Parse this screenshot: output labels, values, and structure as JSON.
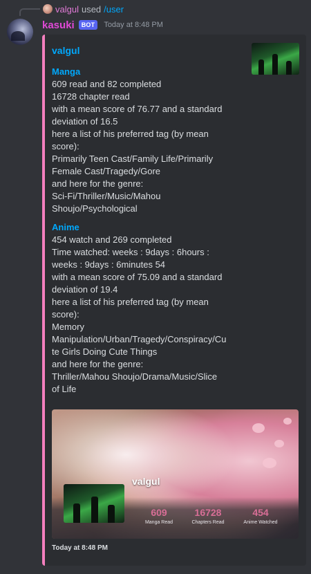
{
  "reply": {
    "username": "valgul",
    "used_text": "used",
    "command": "/user"
  },
  "message": {
    "author": "kasuki",
    "bot_tag": "BOT",
    "timestamp": "Today at 8:48 PM"
  },
  "embed": {
    "title": "valgul",
    "accent_color": "#f47fbe",
    "manga": {
      "heading": "Manga",
      "lines": [
        "609 read and 82 completed",
        "16728 chapter read",
        "with a mean score of 76.77 and a standard",
        "deviation of 16.5",
        "here a list of his preferred tag (by mean",
        "score):",
        "Primarily Teen Cast/Family Life/Primarily",
        "Female Cast/Tragedy/Gore",
        "and here for the genre:",
        "Sci-Fi/Thriller/Music/Mahou",
        "Shoujo/Psychological"
      ]
    },
    "anime": {
      "heading": "Anime",
      "lines": [
        "454 watch and 269 completed",
        "Time watched: weeks : 9days : 6hours :",
        "weeks : 9days : 6minutes 54",
        "with a mean score of 75.09 and a standard",
        "deviation of 19.4",
        "here a list of his preferred tag (by mean",
        "score):",
        "Memory",
        "Manipulation/Urban/Tragedy/Conspiracy/Cu",
        "te Girls Doing Cute Things",
        "and here for the genre:",
        "Thriller/Mahou Shoujo/Drama/Music/Slice",
        "of Life"
      ]
    },
    "banner": {
      "name": "valgul",
      "stats": [
        {
          "value": "609",
          "label": "Manga Read"
        },
        {
          "value": "16728",
          "label": "Chapters Read"
        },
        {
          "value": "454",
          "label": "Anime Watched"
        }
      ]
    },
    "footer": "Today at 8:48 PM"
  }
}
